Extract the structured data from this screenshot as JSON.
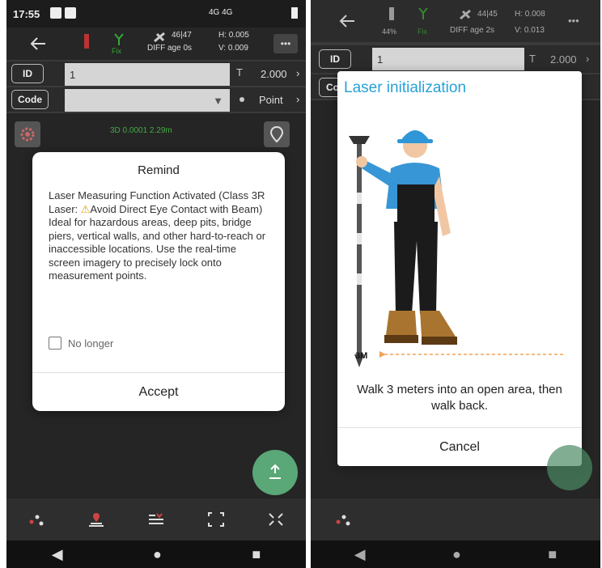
{
  "left": {
    "status": {
      "time": "17:55",
      "icons": "4G 4G"
    },
    "gnss": {
      "sats": "46|47",
      "diff": "DIFF age 0s",
      "h": "H: 0.005",
      "v": "V: 0.009",
      "fix": "Fix"
    },
    "menu": "•••",
    "id_chip": "ID",
    "id_value": "1",
    "height_value": "2.000",
    "code_chip": "Code",
    "point_type": "Point",
    "precision_bar": "3D 0.0001  2.29m",
    "dialog": {
      "title": "Remind",
      "body_part1": "Laser Measuring Function Activated (Class 3R Laser: ",
      "body_part2": "Avoid Direct Eye Contact with Beam) Ideal for hazardous areas, deep pits, bridge piers, vertical walls, and other hard-to-reach or inaccessible locations. Use the real-time screen imagery to precisely lock onto measurement points.",
      "checkbox_label": "No longer",
      "accept": "Accept"
    }
  },
  "right": {
    "gnss": {
      "battery": "44%",
      "fix": "Fix",
      "sats": "44|45",
      "diff": "DIFF age 2s",
      "h": "H: 0.008",
      "v": "V: 0.013"
    },
    "menu": "•••",
    "id_chip": "ID",
    "id_value": "1",
    "height_value": "2.000",
    "code_chip": "Co",
    "dialog": {
      "title": "Laser initialization",
      "distance_label": "3M",
      "instruction": "Walk 3 meters into an open area, then walk back.",
      "cancel": "Cancel"
    }
  },
  "colors": {
    "accent": "#27a2d8",
    "fab": "#5aa777"
  }
}
